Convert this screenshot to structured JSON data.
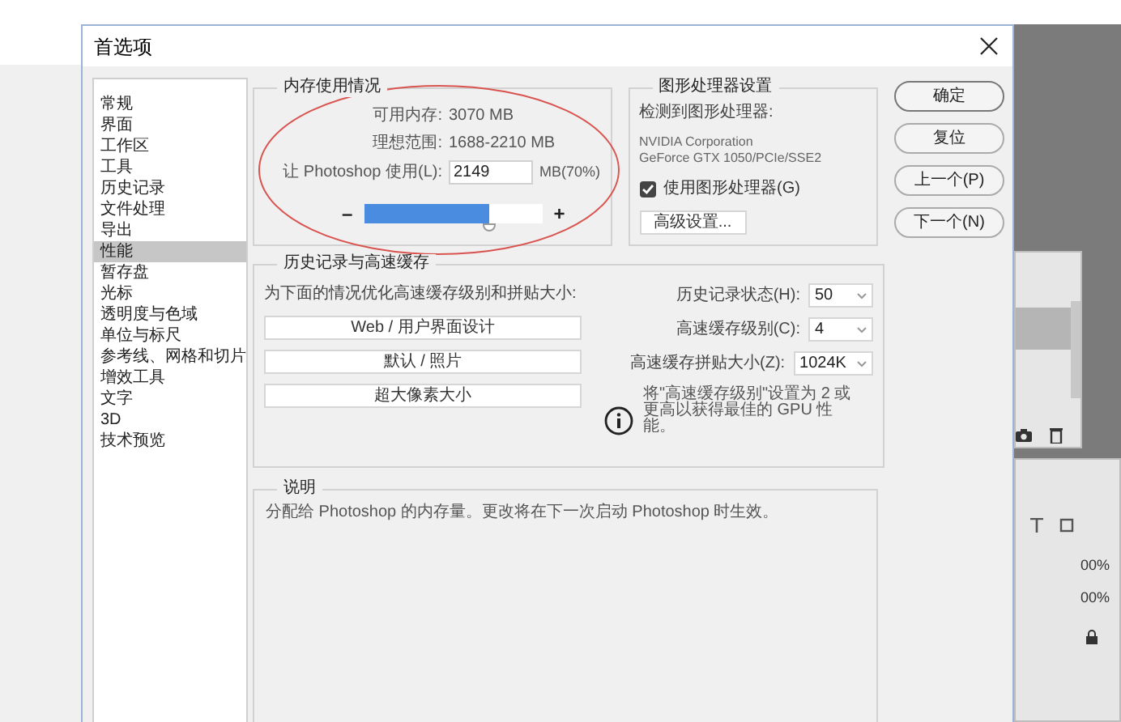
{
  "dialog": {
    "title": "首选项"
  },
  "sidebar": {
    "items": [
      {
        "label": "常规",
        "selected": false
      },
      {
        "label": "界面",
        "selected": false
      },
      {
        "label": "工作区",
        "selected": false
      },
      {
        "label": "工具",
        "selected": false
      },
      {
        "label": "历史记录",
        "selected": false
      },
      {
        "label": "文件处理",
        "selected": false
      },
      {
        "label": "导出",
        "selected": false
      },
      {
        "label": "性能",
        "selected": true
      },
      {
        "label": "暂存盘",
        "selected": false
      },
      {
        "label": "光标",
        "selected": false
      },
      {
        "label": "透明度与色域",
        "selected": false
      },
      {
        "label": "单位与标尺",
        "selected": false
      },
      {
        "label": "参考线、网格和切片",
        "selected": false
      },
      {
        "label": "增效工具",
        "selected": false
      },
      {
        "label": "文字",
        "selected": false
      },
      {
        "label": "3D",
        "selected": false
      },
      {
        "label": "技术预览",
        "selected": false
      }
    ]
  },
  "memory": {
    "title": "内存使用情况",
    "available_label": "可用内存:",
    "available": "3070 MB",
    "ideal_label": "理想范围:",
    "ideal": "1688-2210 MB",
    "use_label": "让 Photoshop 使用(L):",
    "use_value": "2149",
    "percent": "MB(70%)",
    "minus": "–",
    "plus": "+",
    "slider": {
      "level": 0.7
    }
  },
  "gpu": {
    "title": "图形处理器设置",
    "detected_label": "检测到图形处理器:",
    "vendor": "NVIDIA Corporation",
    "model": "GeForce GTX 1050/PCIe/SSE2",
    "use_gpu": {
      "label": "使用图形处理器(G)",
      "checked": true
    },
    "advanced_button": "高级设置..."
  },
  "buttons": [
    "确定",
    "复位",
    "上一个(P)",
    "下一个(N)"
  ],
  "history": {
    "title": "历史记录与高速缓存",
    "optimize_label": "为下面的情况优化高速缓存级别和拼贴大小:",
    "presets": [
      "Web / 用户界面设计",
      "默认 / 照片",
      "超大像素大小"
    ],
    "fields": [
      {
        "label": "历史记录状态(H):",
        "value": "50"
      },
      {
        "label": "高速缓存级别(C):",
        "value": "4"
      },
      {
        "label": "高速缓存拼贴大小(Z):",
        "value": "1024K"
      }
    ],
    "note": "将\"高速缓存级别\"设置为 2 或更高以获得最佳的 GPU 性能。"
  },
  "description": {
    "title": "说明",
    "text": "分配给 Photoshop 的内存量。更改将在下一次启动 Photoshop 时生效。"
  },
  "background_panel": {
    "percents": [
      "00%",
      "00%"
    ]
  }
}
